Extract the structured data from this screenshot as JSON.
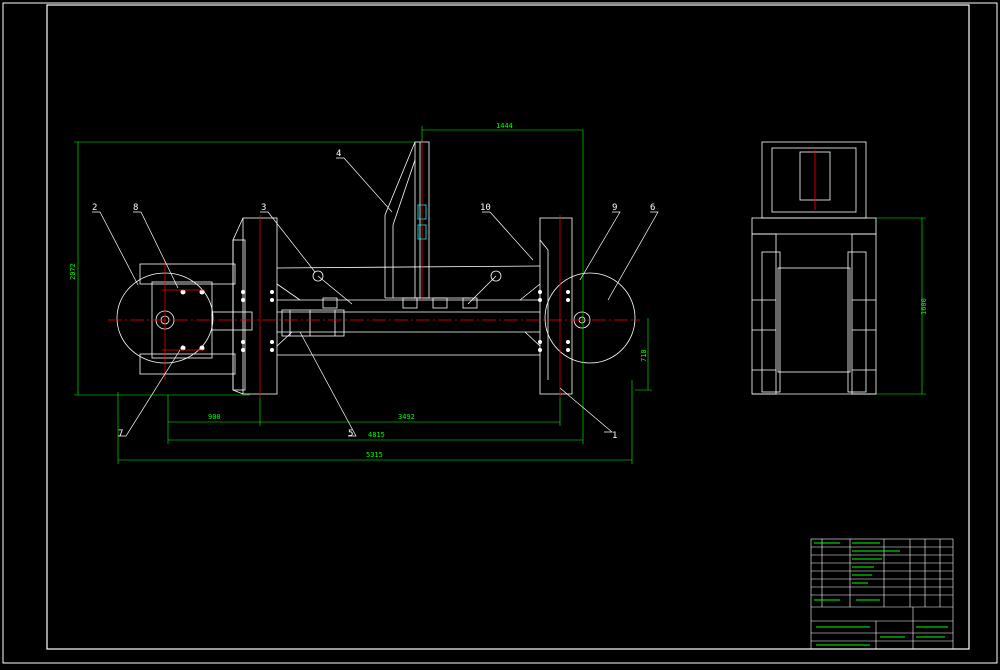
{
  "colors": {
    "background": "#000000",
    "lines": "#ffffff",
    "dimension": "#00ff00",
    "centerline": "#ff0000",
    "highlight": "#00ffff"
  },
  "callouts": {
    "c1": "1",
    "c2": "2",
    "c3": "3",
    "c4": "4",
    "c5": "5",
    "c6": "6",
    "c7": "7",
    "c8": "8",
    "c9": "9",
    "c10": "10",
    "c5b": "5"
  },
  "dimensions": {
    "overall_width": "5315",
    "inner_width": "4815",
    "left_offset": "900",
    "wheelbase": "3492",
    "top_width": "1444",
    "overall_height": "2072",
    "side_height": "1600",
    "axle_height": "710"
  }
}
